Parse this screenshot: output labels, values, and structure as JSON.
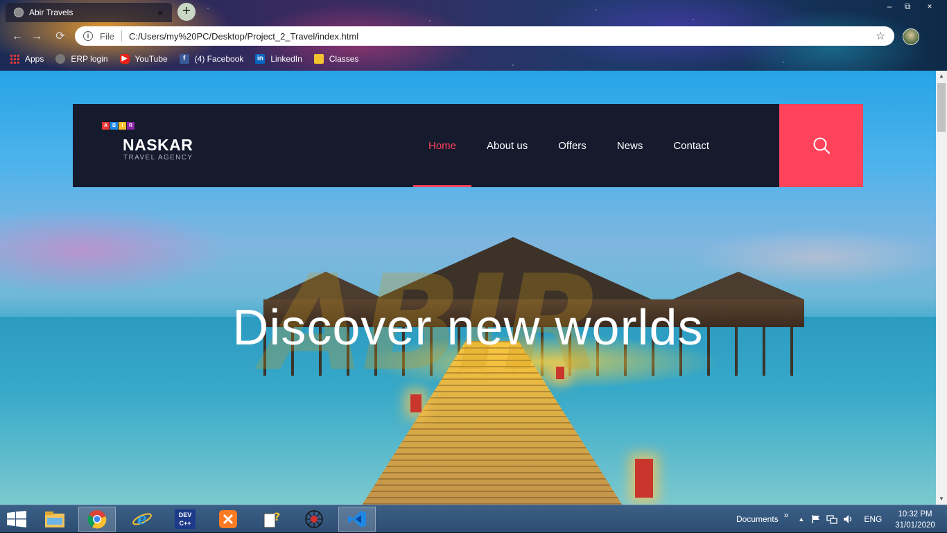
{
  "browser": {
    "tab_title": "Abir Travels",
    "tab_close": "×",
    "new_tab": "+",
    "window_controls": {
      "minimize": "–",
      "maximize": "⧉",
      "close": "×"
    },
    "nav": {
      "back": "←",
      "forward": "→",
      "reload": "⟳"
    },
    "address": {
      "info_glyph": "i",
      "scheme_label": "File",
      "url": "C:/Users/my%20PC/Desktop/Project_2_Travel/index.html",
      "star_glyph": "☆"
    },
    "bookmarks": [
      {
        "label": "Apps",
        "icon": "apps-grid-icon"
      },
      {
        "label": "ERP login",
        "icon": "globe-icon"
      },
      {
        "label": "YouTube",
        "icon": "youtube-icon"
      },
      {
        "label": "(4) Facebook",
        "icon": "facebook-icon"
      },
      {
        "label": "LinkedIn",
        "icon": "linkedin-icon"
      },
      {
        "label": "Classes",
        "icon": "classroom-icon"
      }
    ],
    "bookmark_glyphs": {
      "youtube": "▶",
      "facebook": "f",
      "linkedin": "in"
    }
  },
  "site": {
    "logo": {
      "badge_letters": [
        "A",
        "B",
        "I",
        "R"
      ],
      "badge_colors": [
        "#e53935",
        "#1e88e5",
        "#fbc02d",
        "#8e24aa"
      ],
      "name": "NASKAR",
      "tagline": "TRAVEL AGENCY"
    },
    "nav": [
      {
        "label": "Home",
        "active": true
      },
      {
        "label": "About us",
        "active": false
      },
      {
        "label": "Offers",
        "active": false
      },
      {
        "label": "News",
        "active": false
      },
      {
        "label": "Contact",
        "active": false
      }
    ],
    "search_icon": "search-icon",
    "hero": {
      "watermark": "ABIR",
      "title": "Discover new worlds"
    },
    "colors": {
      "accent": "#fe435b",
      "header_bg": "#151a2d"
    }
  },
  "taskbar": {
    "apps": [
      {
        "name": "file-explorer",
        "active": false
      },
      {
        "name": "chrome",
        "active": true
      },
      {
        "name": "internet-explorer",
        "active": false
      },
      {
        "name": "dev-cpp",
        "active": false,
        "label": "DEV C++"
      },
      {
        "name": "xampp",
        "active": false
      },
      {
        "name": "help-tool",
        "active": false
      },
      {
        "name": "network-tool",
        "active": false
      },
      {
        "name": "vscode",
        "active": true
      }
    ],
    "toolbar_label": "Documents",
    "toolbar_chevron": "»",
    "language": "ENG",
    "time": "10:32 PM",
    "date": "31/01/2020"
  }
}
